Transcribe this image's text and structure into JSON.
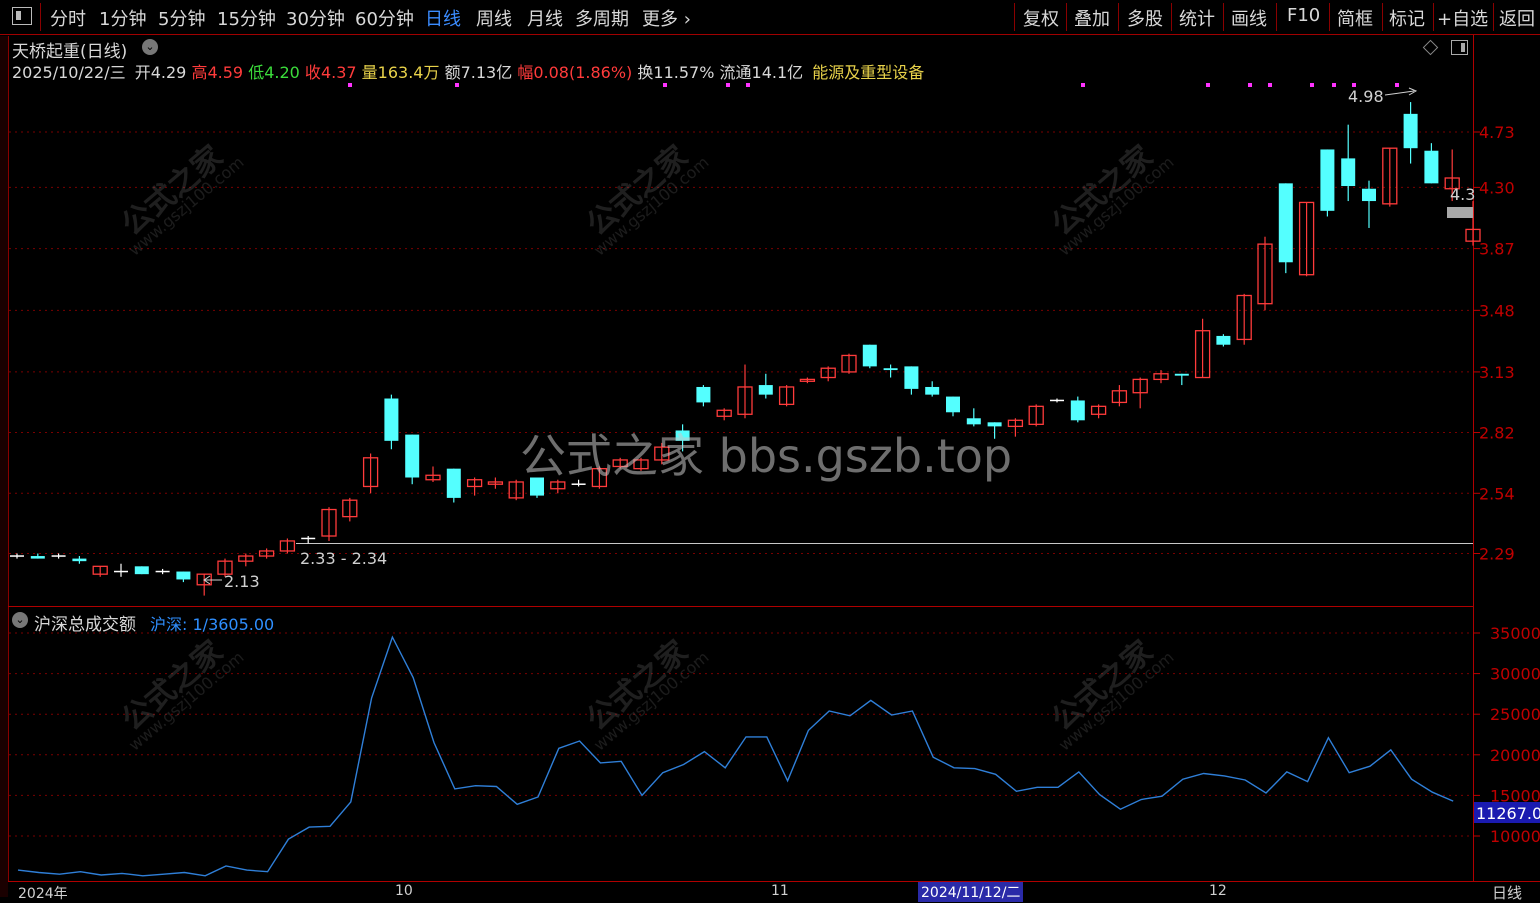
{
  "toolbar": {
    "periods": [
      "分时",
      "1分钟",
      "5分钟",
      "15分钟",
      "30分钟",
      "60分钟",
      "日线",
      "周线",
      "月线",
      "多周期",
      "更多"
    ],
    "active_period": "日线",
    "right_buttons": [
      "复权",
      "叠加",
      "多股",
      "统计",
      "画线",
      "F10",
      "简框",
      "标记",
      "+自选",
      "返回"
    ]
  },
  "header": {
    "title": "天桥起重(日线)",
    "date": "2025/10/22/三",
    "open_label": "开",
    "open": "4.29",
    "high_label": "高",
    "high": "4.59",
    "low_label": "低",
    "low": "4.20",
    "close_label": "收",
    "close": "4.37",
    "volume_label": "量",
    "volume": "163.4万",
    "amount_label": "额",
    "amount": "7.13亿",
    "change_label": "幅",
    "change": "0.08(1.86%)",
    "turnover_label": "换",
    "turnover": "11.57%",
    "float_label": "流通",
    "float": "14.1亿",
    "sector": "能源及重型设备"
  },
  "annotations": {
    "max_label": "4.98",
    "min_label": "2.13",
    "range_label": "2.33 - 2.34",
    "last_price_tag": "4.3"
  },
  "indicator": {
    "name": "沪深总成交额",
    "series_label": "沪深:",
    "series_value": "1/3605.00",
    "last_value_tag": "11267.0"
  },
  "x_axis": {
    "labels": [
      "2024年",
      "10",
      "11",
      "2024/11/12/二",
      "12"
    ],
    "corner_label": "日线"
  },
  "watermarks": {
    "main": "公式之家 bbs.gszb.top",
    "tile_cn": "公式之家",
    "tile_url": "www.gszj100.com"
  },
  "colors": {
    "up": "#ff3b3b",
    "down": "#54ffff",
    "flat": "#ffffff",
    "axis_red": "#c00000",
    "line_blue": "#2f7fd8",
    "magenta": "#ff33ff",
    "sector": "#e8d24a",
    "volume": "#e8d24a",
    "active_tab": "#3b8cff"
  },
  "chart_data": [
    {
      "type": "candlestick",
      "title": "天桥起重(日线)",
      "y_ticks": [
        4.73,
        4.3,
        3.87,
        3.48,
        3.13,
        2.82,
        2.54,
        2.29
      ],
      "ylim": [
        2.05,
        5.0
      ],
      "reference_line": 2.33,
      "candles": [
        [
          2.28,
          2.29,
          2.27,
          2.28
        ],
        [
          2.28,
          2.29,
          2.27,
          2.27
        ],
        [
          2.28,
          2.29,
          2.27,
          2.28
        ],
        [
          2.27,
          2.28,
          2.25,
          2.26
        ],
        [
          2.21,
          2.24,
          2.2,
          2.24
        ],
        [
          2.22,
          2.25,
          2.2,
          2.22
        ],
        [
          2.24,
          2.24,
          2.21,
          2.21
        ],
        [
          2.22,
          2.23,
          2.21,
          2.22
        ],
        [
          2.22,
          2.22,
          2.18,
          2.19
        ],
        [
          2.17,
          2.21,
          2.13,
          2.21
        ],
        [
          2.21,
          2.27,
          2.2,
          2.26
        ],
        [
          2.26,
          2.29,
          2.24,
          2.28
        ],
        [
          2.28,
          2.31,
          2.27,
          2.3
        ],
        [
          2.3,
          2.35,
          2.29,
          2.34
        ],
        [
          2.35,
          2.36,
          2.33,
          2.35
        ],
        [
          2.36,
          2.48,
          2.34,
          2.47
        ],
        [
          2.44,
          2.52,
          2.42,
          2.51
        ],
        [
          2.57,
          2.72,
          2.54,
          2.7
        ],
        [
          2.99,
          3.01,
          2.74,
          2.78
        ],
        [
          2.81,
          2.81,
          2.58,
          2.61
        ],
        [
          2.6,
          2.66,
          2.59,
          2.62
        ],
        [
          2.65,
          2.65,
          2.5,
          2.52
        ],
        [
          2.57,
          2.61,
          2.53,
          2.6
        ],
        [
          2.58,
          2.61,
          2.56,
          2.59
        ],
        [
          2.52,
          2.6,
          2.51,
          2.59
        ],
        [
          2.61,
          2.61,
          2.52,
          2.53
        ],
        [
          2.56,
          2.6,
          2.54,
          2.59
        ],
        [
          2.58,
          2.6,
          2.57,
          2.58
        ],
        [
          2.57,
          2.66,
          2.56,
          2.65
        ],
        [
          2.66,
          2.7,
          2.65,
          2.69
        ],
        [
          2.65,
          2.7,
          2.64,
          2.69
        ],
        [
          2.69,
          2.77,
          2.67,
          2.75
        ],
        [
          2.83,
          2.86,
          2.73,
          2.78
        ],
        [
          3.05,
          3.06,
          2.95,
          2.97
        ],
        [
          2.9,
          2.94,
          2.88,
          2.93
        ],
        [
          2.91,
          3.17,
          2.89,
          3.05
        ],
        [
          3.06,
          3.12,
          2.99,
          3.01
        ],
        [
          2.96,
          3.06,
          2.95,
          3.05
        ],
        [
          3.08,
          3.1,
          3.07,
          3.09
        ],
        [
          3.1,
          3.16,
          3.08,
          3.15
        ],
        [
          3.13,
          3.23,
          3.12,
          3.22
        ],
        [
          3.28,
          3.28,
          3.15,
          3.16
        ],
        [
          3.15,
          3.17,
          3.1,
          3.14
        ],
        [
          3.16,
          3.16,
          3.01,
          3.04
        ],
        [
          3.05,
          3.08,
          3.0,
          3.01
        ],
        [
          3.0,
          3.0,
          2.9,
          2.92
        ],
        [
          2.89,
          2.94,
          2.85,
          2.86
        ],
        [
          2.87,
          2.87,
          2.79,
          2.85
        ],
        [
          2.85,
          2.89,
          2.8,
          2.88
        ],
        [
          2.86,
          2.96,
          2.85,
          2.95
        ],
        [
          2.98,
          2.99,
          2.97,
          2.98
        ],
        [
          2.98,
          3.0,
          2.87,
          2.88
        ],
        [
          2.91,
          2.96,
          2.89,
          2.95
        ],
        [
          2.97,
          3.06,
          2.95,
          3.03
        ],
        [
          3.02,
          3.1,
          2.94,
          3.09
        ],
        [
          3.09,
          3.14,
          3.07,
          3.12
        ],
        [
          3.12,
          3.12,
          3.06,
          3.11
        ],
        [
          3.1,
          3.43,
          3.1,
          3.36
        ],
        [
          3.33,
          3.34,
          3.27,
          3.28
        ],
        [
          3.31,
          3.58,
          3.28,
          3.57
        ],
        [
          3.52,
          3.95,
          3.48,
          3.9
        ],
        [
          4.33,
          4.33,
          3.71,
          3.78
        ],
        [
          3.7,
          4.19,
          3.69,
          4.19
        ],
        [
          4.59,
          4.59,
          4.09,
          4.13
        ],
        [
          4.52,
          4.79,
          4.2,
          4.31
        ],
        [
          4.29,
          4.35,
          4.01,
          4.2
        ],
        [
          4.18,
          4.6,
          4.16,
          4.6
        ],
        [
          4.88,
          4.98,
          4.48,
          4.6
        ],
        [
          4.58,
          4.64,
          4.33,
          4.33
        ],
        [
          4.29,
          4.59,
          4.2,
          4.37
        ],
        [
          3.92,
          4.2,
          3.89,
          4.0
        ]
      ]
    },
    {
      "type": "line",
      "title": "沪深总成交额",
      "y_ticks": [
        35000,
        30000,
        25000,
        20000,
        15000,
        10000
      ],
      "ylim": [
        5000,
        37500
      ],
      "series": [
        {
          "name": "沪深",
          "values": [
            5800,
            5500,
            5300,
            5600,
            5200,
            5400,
            5100,
            5300,
            5500,
            5100,
            6300,
            5800,
            5600,
            9600,
            11100,
            11200,
            14200,
            27000,
            34500,
            29500,
            21500,
            15800,
            16200,
            16100,
            13900,
            14800,
            20800,
            21700,
            19000,
            19200,
            15000,
            17800,
            18800,
            20400,
            18400,
            22200,
            22200,
            16800,
            23000,
            25400,
            24800,
            26700,
            24900,
            25400,
            19700,
            18400,
            18300,
            17600,
            15500,
            16000,
            16000,
            17900,
            15100,
            13300,
            14500,
            14900,
            17000,
            17700,
            17400,
            16900,
            15300,
            17900,
            16700,
            22100,
            17800,
            18600,
            20600,
            17000,
            15400,
            14300
          ]
        }
      ]
    }
  ]
}
